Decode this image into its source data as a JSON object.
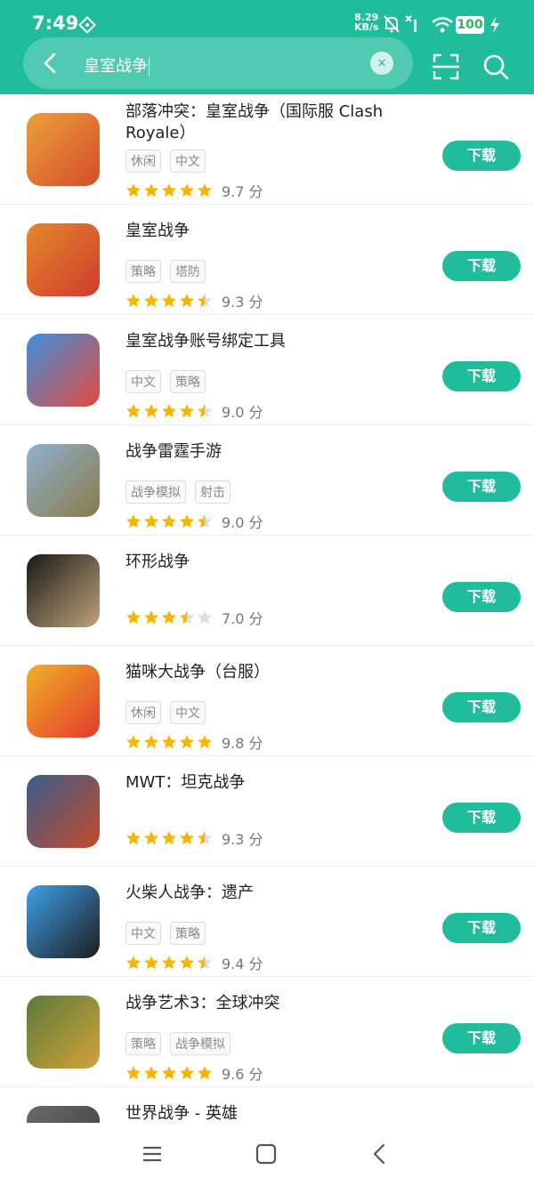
{
  "status_bar": {
    "time": "7:49",
    "net_speed_value": "8.29",
    "net_speed_unit": "KB/s",
    "battery": "100"
  },
  "search": {
    "query": "皇室战争",
    "clear_label": "×"
  },
  "apps": [
    {
      "name": "部落冲突：皇室战争（国际服 Clash Royale）",
      "tags": [
        "休闲",
        "中文"
      ],
      "rating": 5,
      "score": "9.7 分",
      "download": "下载",
      "icon_colors": [
        "#e8a23a",
        "#d94a2b"
      ]
    },
    {
      "name": "皇室战争",
      "tags": [
        "策略",
        "塔防"
      ],
      "rating": 4.5,
      "score": "9.3 分",
      "download": "下载",
      "icon_colors": [
        "#e2892a",
        "#d23a2f"
      ]
    },
    {
      "name": "皇室战争账号绑定工具",
      "tags": [
        "中文",
        "策略"
      ],
      "rating": 4.5,
      "score": "9.0 分",
      "download": "下载",
      "icon_colors": [
        "#3d8fe0",
        "#e24a3a"
      ]
    },
    {
      "name": "战争雷霆手游",
      "tags": [
        "战争模拟",
        "射击"
      ],
      "rating": 4.5,
      "score": "9.0 分",
      "download": "下载",
      "icon_colors": [
        "#8fb1cf",
        "#8a7a4a"
      ]
    },
    {
      "name": "环形战争",
      "tags": [],
      "rating": 3.5,
      "score": "7.0 分",
      "download": "下载",
      "icon_colors": [
        "#1a1a1a",
        "#bfa477"
      ]
    },
    {
      "name": "猫咪大战争（台服）",
      "tags": [
        "休闲",
        "中文"
      ],
      "rating": 5,
      "score": "9.8 分",
      "download": "下载",
      "icon_colors": [
        "#f2b12a",
        "#e23a2a"
      ]
    },
    {
      "name": "MWT：坦克战争",
      "tags": [],
      "rating": 4.5,
      "score": "9.3 分",
      "download": "下载",
      "icon_colors": [
        "#3a5d8c",
        "#c44a2a"
      ]
    },
    {
      "name": "火柴人战争：遗产",
      "tags": [
        "中文",
        "策略"
      ],
      "rating": 4.5,
      "score": "9.4 分",
      "download": "下载",
      "icon_colors": [
        "#3ea0e8",
        "#1c1c1c"
      ]
    },
    {
      "name": "战争艺术3：全球冲突",
      "tags": [
        "策略",
        "战争模拟"
      ],
      "rating": 5,
      "score": "9.6 分",
      "download": "下载",
      "icon_colors": [
        "#5b7a3a",
        "#d4a23a"
      ]
    },
    {
      "name": "世界战争 - 英雄",
      "tags": [],
      "rating": 0,
      "score": "",
      "download": "",
      "icon_colors": [
        "#6a6a6a",
        "#3a3a3a"
      ]
    }
  ],
  "colors": {
    "accent": "#1fbd9c",
    "star_on": "#f7b500",
    "star_off": "#dddddd"
  }
}
